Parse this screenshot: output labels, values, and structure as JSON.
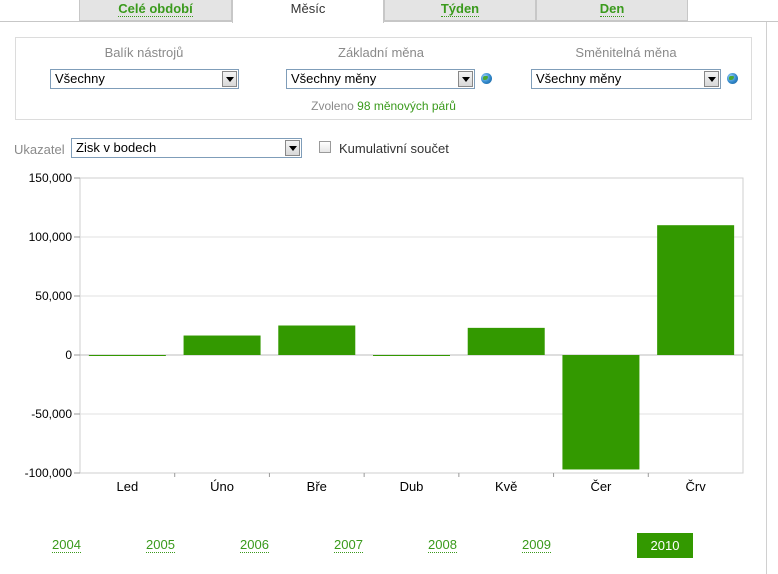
{
  "tabs": [
    {
      "label": "Celé období",
      "active": false
    },
    {
      "label": "Měsíc",
      "active": true
    },
    {
      "label": "Týden",
      "active": false
    },
    {
      "label": "Den",
      "active": false
    }
  ],
  "filters": {
    "toolkit": {
      "label": "Balík nástrojů",
      "value": "Všechny"
    },
    "base_currency": {
      "label": "Základní měna",
      "value": "Všechny měny"
    },
    "quote_currency": {
      "label": "Směnitelná měna",
      "value": "Všechny měny"
    },
    "selected_prefix": "Zvoleno",
    "selected_count": "98 měnových párů"
  },
  "indicator": {
    "label": "Ukazatel",
    "value": "Zisk v bodech",
    "cumulative_label": "Kumulativní součet",
    "cumulative_checked": false
  },
  "chart_data": {
    "type": "bar",
    "categories": [
      "Led",
      "Úno",
      "Bře",
      "Dub",
      "Kvě",
      "Čer",
      "Črv"
    ],
    "values": [
      -500,
      16500,
      25000,
      -500,
      23000,
      -97000,
      110000
    ],
    "ylim": [
      -100000,
      150000
    ],
    "yticks": [
      "150,000",
      "100,000",
      "50,000",
      "0",
      "-50,000",
      "-100,000"
    ],
    "ytick_values": [
      150000,
      100000,
      50000,
      0,
      -50000,
      -100000
    ],
    "bar_color": "#339900",
    "grid": true
  },
  "years": {
    "items": [
      "2004",
      "2005",
      "2006",
      "2007",
      "2008",
      "2009",
      "2010"
    ],
    "active": "2010"
  },
  "colors": {
    "accent": "#3a9a1c",
    "bar": "#339900"
  }
}
